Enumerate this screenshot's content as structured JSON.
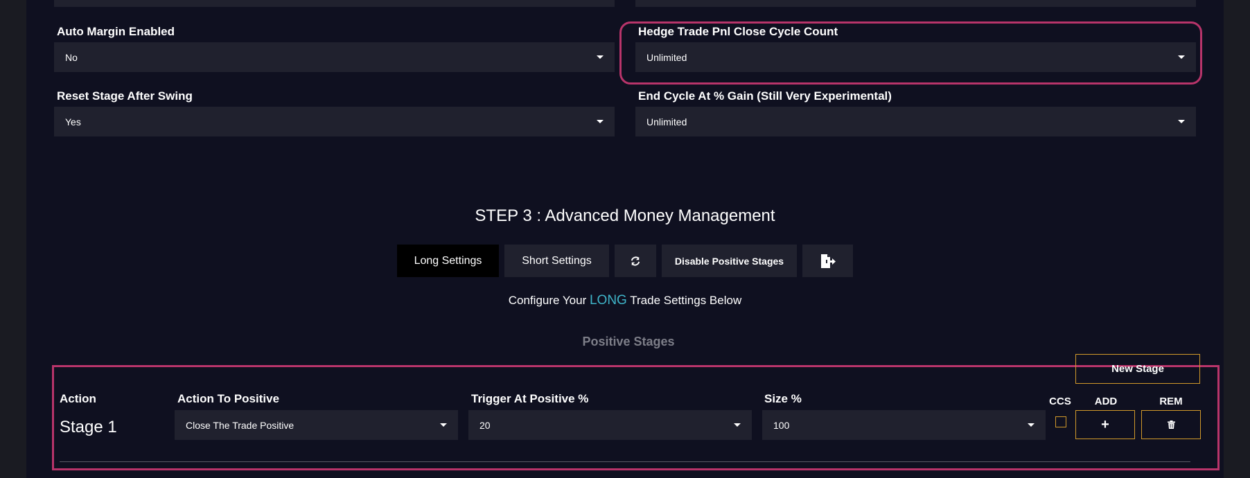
{
  "fields": {
    "auto_margin": {
      "label": "Auto Margin Enabled",
      "value": "No"
    },
    "hedge_pnl": {
      "label": "Hedge Trade Pnl Close Cycle Count",
      "value": "Unlimited"
    },
    "reset_stage": {
      "label": "Reset Stage After Swing",
      "value": "Yes"
    },
    "end_cycle": {
      "label": "End Cycle At % Gain (Still Very Experimental)",
      "value": "Unlimited"
    }
  },
  "step3": {
    "title": "STEP 3 : Advanced Money Management",
    "tabs": {
      "long": "Long Settings",
      "short": "Short Settings",
      "disable": "Disable Positive Stages"
    },
    "configure_prefix": "Configure Your",
    "configure_highlight": "LONG",
    "configure_suffix": "Trade Settings Below",
    "section_title": "Positive Stages",
    "new_stage": "New Stage"
  },
  "stages_table": {
    "headers": {
      "action": "Action",
      "action_to_positive": "Action To Positive",
      "trigger": "Trigger At Positive %",
      "size": "Size %",
      "ccs": "CCS",
      "add": "ADD",
      "rem": "REM"
    },
    "rows": [
      {
        "stage": "Stage 1",
        "action": "Close The Trade Positive",
        "trigger": "20",
        "size": "100"
      }
    ]
  },
  "colors": {
    "highlight": "#b8346a",
    "accent": "#3fb5c9",
    "outline_button": "#d29a2a"
  }
}
